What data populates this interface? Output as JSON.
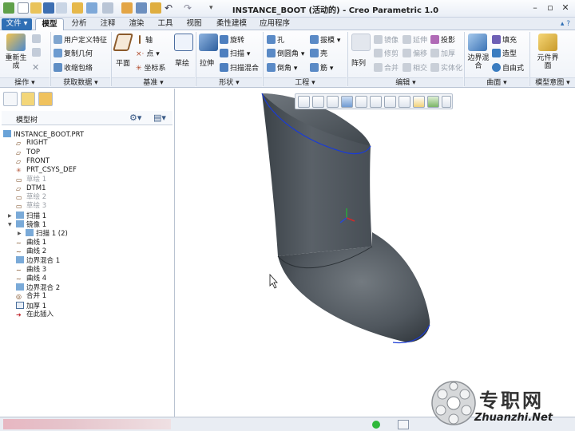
{
  "window": {
    "title": "INSTANCE_BOOT (活动的) - Creo Parametric 1.0"
  },
  "menu": {
    "file": "文件"
  },
  "tabs": [
    "模型",
    "分析",
    "注释",
    "渲染",
    "工具",
    "视图",
    "柔性建模",
    "应用程序"
  ],
  "ribbon": {
    "ops": {
      "regenerate": "重新生成",
      "label": "操作"
    },
    "getdata": {
      "udf": "用户定义特征",
      "copy_geom": "复制几何",
      "shrinkwrap": "收缩包络",
      "label": "获取数据"
    },
    "datum": {
      "plane": "平面",
      "axis": "轴",
      "point": "点",
      "csys": "坐标系",
      "sketch": "草绘",
      "label": "基准"
    },
    "shapes": {
      "extrude": "拉伸",
      "revolve": "旋转",
      "sweep": "扫描",
      "sweep_blend": "扫描混合",
      "label": "形状"
    },
    "engineering": {
      "hole": "孔",
      "draft": "拔模",
      "round": "倒圆角",
      "shell": "壳",
      "chamfer": "倒角",
      "rib": "筋",
      "label": "工程"
    },
    "editing": {
      "pattern": "阵列",
      "mirror": "镜像",
      "extend": "延伸",
      "project": "投影",
      "trim": "修剪",
      "offset": "偏移",
      "thicken": "加厚",
      "merge": "合并",
      "intersect": "相交",
      "solidify": "实体化",
      "label": "编辑"
    },
    "surfaces": {
      "boundary_blend": "边界混合",
      "fill": "填充",
      "style": "造型",
      "freestyle": "自由式",
      "label": "曲面"
    },
    "intent": {
      "component_interface": "元件界面",
      "label": "模型意图"
    }
  },
  "tree": {
    "title": "模型树",
    "items": [
      {
        "label": "INSTANCE_BOOT.PRT",
        "indent": 0,
        "icon": "part-icon",
        "gray": false
      },
      {
        "label": "RIGHT",
        "indent": 1,
        "icon": "datum-plane-icon",
        "gray": false
      },
      {
        "label": "TOP",
        "indent": 1,
        "icon": "datum-plane-icon",
        "gray": false
      },
      {
        "label": "FRONT",
        "indent": 1,
        "icon": "datum-plane-icon",
        "gray": false
      },
      {
        "label": "PRT_CSYS_DEF",
        "indent": 1,
        "icon": "csys-icon",
        "gray": false
      },
      {
        "label": "草绘 1",
        "indent": 1,
        "icon": "sketch-icon",
        "gray": true
      },
      {
        "label": "DTM1",
        "indent": 1,
        "icon": "datum-plane-icon",
        "gray": false
      },
      {
        "label": "草绘 2",
        "indent": 1,
        "icon": "sketch-icon",
        "gray": true
      },
      {
        "label": "草绘 3",
        "indent": 1,
        "icon": "sketch-icon",
        "gray": true
      },
      {
        "label": "扫描 1",
        "indent": 1,
        "icon": "sweep-icon",
        "gray": false,
        "expander": "▶"
      },
      {
        "label": "镜像 1",
        "indent": 1,
        "icon": "mirror-icon",
        "gray": false,
        "expander": "▼"
      },
      {
        "label": "扫描 1 (2)",
        "indent": 2,
        "icon": "sweep-icon",
        "gray": false,
        "expander": "▶"
      },
      {
        "label": "曲线 1",
        "indent": 1,
        "icon": "curve-icon",
        "gray": false
      },
      {
        "label": "曲线 2",
        "indent": 1,
        "icon": "curve-icon",
        "gray": false
      },
      {
        "label": "边界混合 1",
        "indent": 1,
        "icon": "boundary-blend-icon",
        "gray": false
      },
      {
        "label": "曲线 3",
        "indent": 1,
        "icon": "curve-icon",
        "gray": false
      },
      {
        "label": "曲线 4",
        "indent": 1,
        "icon": "curve-icon",
        "gray": false
      },
      {
        "label": "边界混合 2",
        "indent": 1,
        "icon": "boundary-blend-icon",
        "gray": false
      },
      {
        "label": "合并 1",
        "indent": 1,
        "icon": "merge-icon",
        "gray": false
      },
      {
        "label": "加厚 1",
        "indent": 1,
        "icon": "thicken-icon",
        "gray": false
      },
      {
        "label": "在此插入",
        "indent": 1,
        "icon": "insert-here-icon",
        "gray": false
      }
    ]
  },
  "watermark": {
    "brand": "专职网",
    "url": "Zhuanzhi.Net"
  },
  "colors": {
    "accent": "#2f6fb5",
    "model": "#4a5157",
    "edge": "#1a3bd6"
  }
}
